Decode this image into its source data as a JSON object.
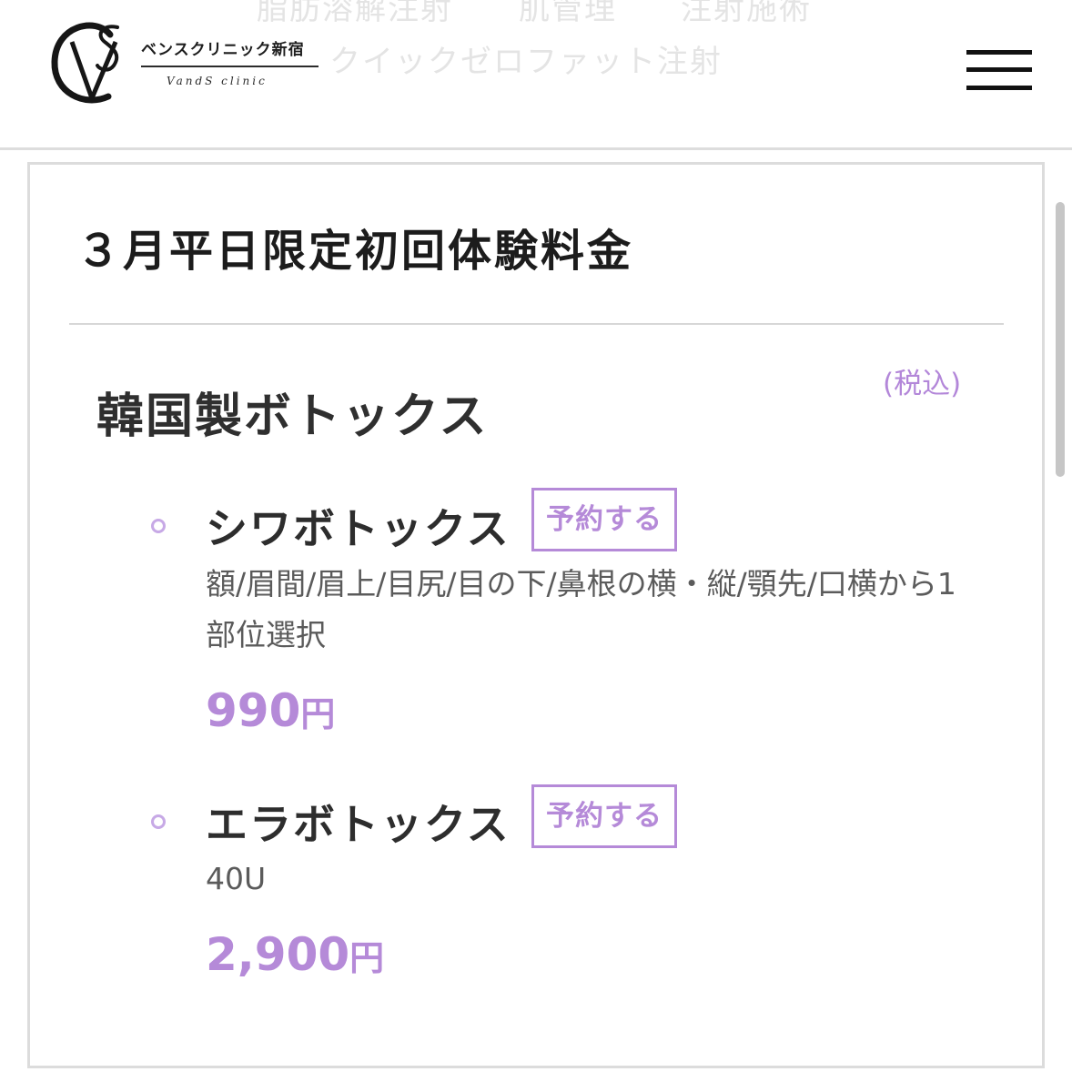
{
  "header": {
    "nav_links": [
      "脂肪溶解注射",
      "肌管理",
      "注射施術",
      "クイックゼロファット注射"
    ],
    "logo": {
      "name_jp": "ベンスクリニック新宿",
      "name_en": "VandS clinic"
    },
    "menu_icon": "hamburger-icon"
  },
  "card": {
    "title": "３月平日限定初回体験料金",
    "tax_note": "(税込)",
    "section_title": "韓国製ボトックス",
    "items": [
      {
        "name": "シワボトックス",
        "reserve_label": "予約する",
        "description": "額/眉間/眉上/目尻/目の下/鼻根の横・縦/顎先/口横から1部位選択",
        "price_number": "990",
        "price_unit": "円"
      },
      {
        "name": "エラボトックス",
        "reserve_label": "予約する",
        "description": "40U",
        "price_number": "2,900",
        "price_unit": "円"
      }
    ]
  },
  "colors": {
    "accent": "#b58ad8",
    "bullet": "#c7a9e6",
    "text": "#2d2d2d",
    "border": "#dcdcdc"
  }
}
